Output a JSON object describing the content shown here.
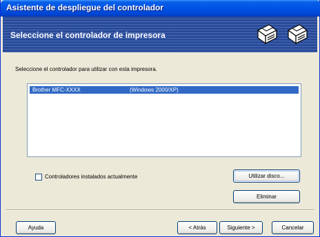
{
  "window": {
    "title": "Asistente de despliegue del controlador"
  },
  "header": {
    "title": "Seleccione el controlador de impresora",
    "icons": [
      "printer-icon",
      "printer-icon"
    ]
  },
  "instruction": "Seleccione el controlador para utilizar con esta impresora.",
  "drivers": [
    {
      "name": "Brother  MFC-XXXX",
      "os": "(Windows 2000/XP)",
      "selected": true
    }
  ],
  "checkbox": {
    "label": "Controladores instalados actualmente",
    "checked": false
  },
  "buttons": {
    "use_disk": "Utilizar disco...",
    "delete": "Eliminar",
    "help": "Ayuda",
    "back": "< Atrás",
    "next": "Siguiente >",
    "cancel": "Cancelar"
  },
  "colors": {
    "titlebar": "#0055e5",
    "header": "#274a9b",
    "selection": "#316ac5",
    "face": "#ece9d8"
  }
}
